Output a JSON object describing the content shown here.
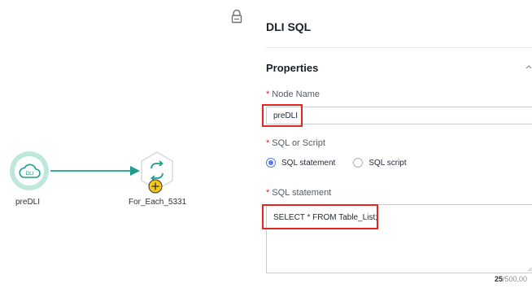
{
  "canvas": {
    "nodes": [
      {
        "label": "preDLI",
        "icon": "cloud-dli-icon",
        "text": "DLI"
      },
      {
        "label": "For_Each_5331",
        "icon": "loop-icon"
      }
    ],
    "connector": "arrow"
  },
  "panel": {
    "title": "DLI SQL",
    "section_title": "Properties",
    "node_name": {
      "label": "Node Name",
      "required_mark": "*",
      "value": "preDLI"
    },
    "sql_or_script": {
      "label": "SQL or Script",
      "required_mark": "*",
      "options": [
        "SQL statement",
        "SQL script"
      ],
      "selected": "SQL statement"
    },
    "sql_statement": {
      "label": "SQL statement",
      "required_mark": "*",
      "value": "SELECT * FROM Table_List;",
      "count": "25",
      "max": "/500,00"
    }
  },
  "colors": {
    "accent": "#5e7ce0",
    "highlight": "#e3261f",
    "node_teal": "#1e9e8c"
  }
}
